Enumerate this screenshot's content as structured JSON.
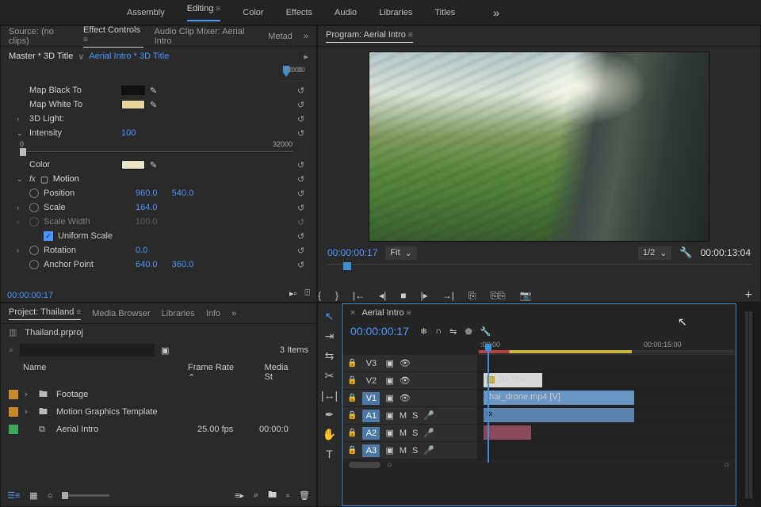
{
  "workspaces": [
    "Assembly",
    "Editing",
    "Color",
    "Effects",
    "Audio",
    "Libraries",
    "Titles"
  ],
  "active_ws": "Editing",
  "source": {
    "tabs": [
      "Source: (no clips)",
      "Effect Controls",
      "Audio Clip Mixer: Aerial Intro",
      "Metad"
    ],
    "active_tab": "Effect Controls",
    "master": "Master * 3D Title",
    "clip": "Aerial Intro * 3D Title",
    "ruler": {
      "start": ":00:00",
      "end": "00:00"
    },
    "props": {
      "map_black": "Map Black To",
      "map_white": "Map White To",
      "light": "3D Light:",
      "intensity": "Intensity",
      "intensity_v": "100",
      "int_min": "0",
      "int_max": "32000",
      "color": "Color",
      "motion": "Motion",
      "position": "Position",
      "pos_x": "960.0",
      "pos_y": "540.0",
      "scale": "Scale",
      "scale_v": "164.0",
      "scale_w": "Scale Width",
      "scale_wv": "100.0",
      "uniform": "Uniform Scale",
      "rotation": "Rotation",
      "rot_v": "0.0",
      "anchor": "Anchor Point",
      "anc_x": "640.0",
      "anc_y": "360.0"
    },
    "tc": "00:00:00:17"
  },
  "program": {
    "tab": "Program: Aerial Intro",
    "tc_l": "00:00:00:17",
    "fit": "Fit",
    "zoom": "1/2",
    "tc_r": "00:00:13:04"
  },
  "project": {
    "tabs": [
      "Project: Thailand",
      "Media Browser",
      "Libraries",
      "Info"
    ],
    "active": "Project: Thailand",
    "file": "Thailand.prproj",
    "count": "3 Items",
    "cols": {
      "name": "Name",
      "fr": "Frame Rate",
      "ms": "Media St"
    },
    "items": [
      {
        "color": "#c88a2a",
        "name": "Footage",
        "fr": "",
        "ms": ""
      },
      {
        "color": "#c88a2a",
        "name": "Motion Graphics Template",
        "fr": "",
        "ms": ""
      },
      {
        "color": "#3aaa5a",
        "name": "Aerial Intro",
        "fr": "25.00 fps",
        "ms": "00:00:0"
      }
    ]
  },
  "timeline": {
    "seq": "Aerial Intro",
    "tc": "00:00:00:17",
    "ruler": {
      "t0": ":00:00",
      "t1": "00:00:15:00"
    },
    "tracks": {
      "v3": {
        "name": "V3",
        "clip": ""
      },
      "v2": {
        "name": "V2",
        "clip": "3D Title"
      },
      "v1": {
        "name": "V1",
        "clip": "thai_drone.mp4 [V]"
      },
      "a1": {
        "name": "A1"
      },
      "a2": {
        "name": "A2"
      },
      "a3": {
        "name": "A3"
      }
    }
  }
}
